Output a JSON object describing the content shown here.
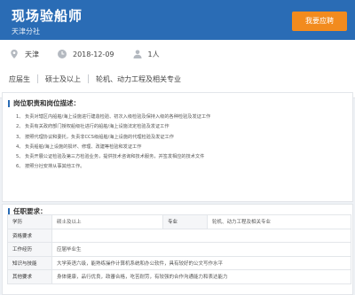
{
  "header": {
    "job_title": "现场验船师",
    "company": "天津分社",
    "apply_label": "我要应聘"
  },
  "meta": {
    "location": "天津",
    "date": "2018-12-09",
    "headcount": "1人",
    "tags": [
      "应届生",
      "硕士及以上",
      "轮机、动力工程及相关专业"
    ]
  },
  "duties": {
    "title": "岗位职责和岗位描述：",
    "items": [
      {
        "num": "1、",
        "text": "负责对辖区内船舶/海上设施进行建造检验、初次入级检验及保持入级的各种检验及发证工作"
      },
      {
        "num": "2、",
        "text": "负责有关政府部门授权船级社进行的船舶/海上设施法定检验及发证工作"
      },
      {
        "num": "3、",
        "text": "按照代理协议和委托，负责非CCS级船舶/海上设施的代理检验及发证工作"
      },
      {
        "num": "4、",
        "text": "负责船舶/海上设施的损坏、修理、改建等检验和发证工作"
      },
      {
        "num": "5、",
        "text": "负责开展公证检验及第三方检验业务，提供技术咨询和技术服务，并签发相应的技术文件"
      },
      {
        "num": "6、",
        "text": "按照分社安排从事其他工作。"
      }
    ]
  },
  "requirements": {
    "title": "任职要求：",
    "rows": [
      {
        "k1": "学历",
        "v1": "硕士及以上",
        "k2": "专业",
        "v2": "轮机、动力工程及相关专业"
      },
      {
        "k1": "资格要求",
        "v1": ""
      },
      {
        "k1": "工作经历",
        "v1": "应届毕业生"
      },
      {
        "k1": "知识与技能",
        "v1": "大学英语六级，能熟练操作计算机系统和办公软件，具有较好的公文写作水平"
      },
      {
        "k1": "其他要求",
        "v1": "身体健康，品行优良，政審合格，吃苦耐劳，有较强的合作沟通能力和表达能力"
      }
    ]
  },
  "colors": {
    "header_bg": "#2a6cb5",
    "apply_btn": "#f28b1e"
  }
}
